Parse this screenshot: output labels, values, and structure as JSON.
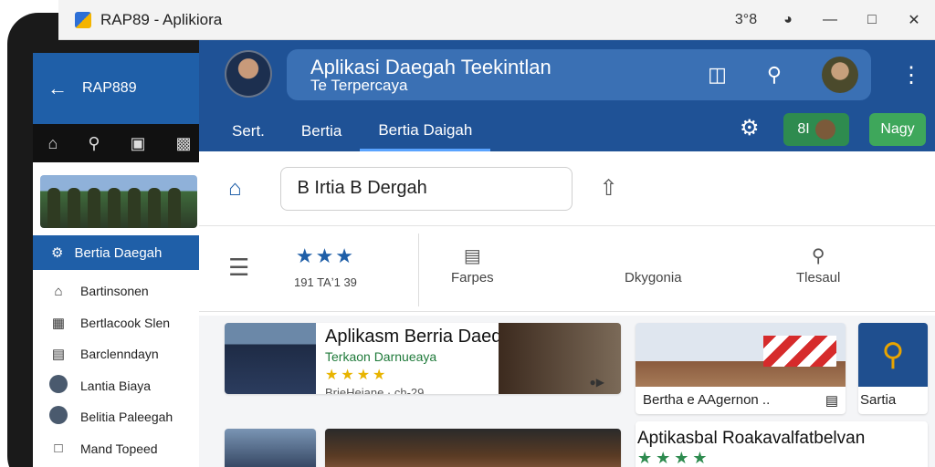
{
  "window": {
    "title": "RAP89 - Aplikiora",
    "status": "3°8",
    "minimize": "—",
    "maximize": "□",
    "close": "✕"
  },
  "phone": {
    "header_title": "RAP889",
    "back": "←",
    "active_item": "Bertia Daegah",
    "items": [
      {
        "label": "Bartinsonen",
        "icon": "home-icon"
      },
      {
        "label": "Bertlacook Slen",
        "icon": "building-icon"
      },
      {
        "label": "Barclenndayn",
        "icon": "document-icon"
      },
      {
        "label": "Lantia Biaya",
        "icon": "person-avatar-icon"
      },
      {
        "label": "Belitia Paleegah",
        "icon": "person-avatar-icon"
      },
      {
        "label": "Mand Topeed",
        "icon": "message-icon"
      }
    ]
  },
  "header": {
    "title": "Aplikasi Daegah Teekintlan",
    "subtitle": "Te Terpercaya",
    "more": "⋮"
  },
  "tabs": [
    {
      "label": "Sert.",
      "active": false
    },
    {
      "label": "Bertia",
      "active": false
    },
    {
      "label": "Bertia Daigah",
      "active": true
    }
  ],
  "toolbar": {
    "badge_label": "8I",
    "green_button": "Nagy"
  },
  "address": {
    "value": "B Irtia B Dergah"
  },
  "categories": {
    "rating_stars": "★★★",
    "rating_label": "191 TAʼ1 39",
    "items": [
      {
        "label": "Farpes",
        "icon": "calendar-icon"
      },
      {
        "label": "Dkygonia",
        "icon": "blank-icon"
      },
      {
        "label": "Tlesaul",
        "icon": "search-icon"
      }
    ]
  },
  "cards": {
    "featured": {
      "title": "Aplikasm Berria Daedah",
      "subtitle": "Terkaon Darnueaya",
      "stars": "★★★★",
      "meta": "BrieHejane · ch-29",
      "tag": "●▶"
    },
    "news": {
      "caption": "Bertha e AAgernon ..",
      "icon": "▤"
    },
    "side": {
      "caption": "Sartia"
    },
    "bottom": {
      "title": "Aptikasbal Roakavalfatbelvan",
      "stars": "★★★★"
    }
  },
  "colors": {
    "primary": "#1f5296",
    "accent_green": "#2e8b4f",
    "star_gold": "#e8b400"
  }
}
